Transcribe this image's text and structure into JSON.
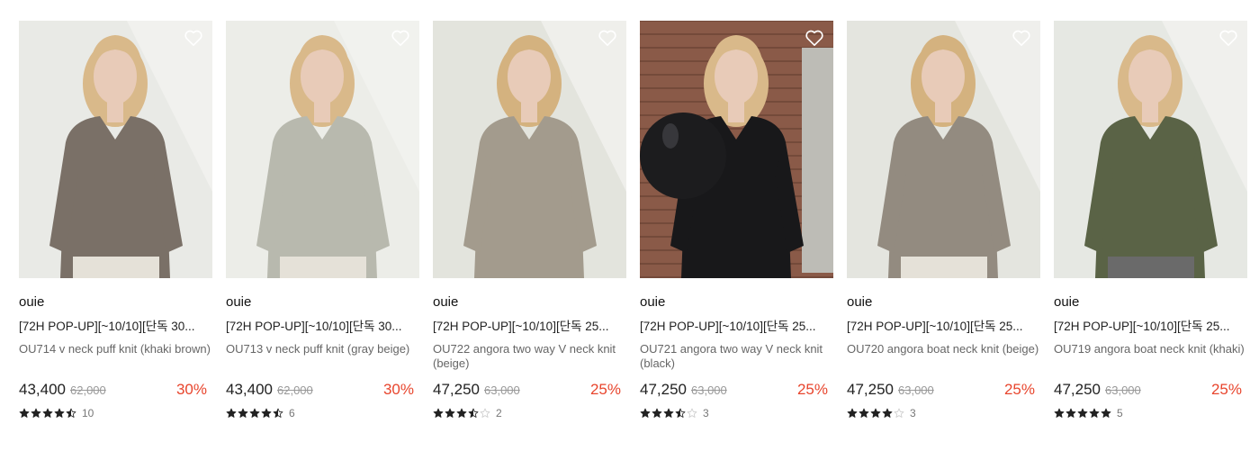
{
  "products": [
    {
      "brand": "ouie",
      "title": "[72H POP-UP][~10/10][단독 30...",
      "desc": "OU714 v neck puff knit (khaki brown)",
      "price": "43,400",
      "original_price": "62,000",
      "discount": "30%",
      "rating": 4.5,
      "review_count": "10",
      "liked": false,
      "colors": {
        "bg": "#e9eae6",
        "garment": "#7a7067",
        "hair": "#d9b98a",
        "skin": "#e8cbb8"
      }
    },
    {
      "brand": "ouie",
      "title": "[72H POP-UP][~10/10][단독 30...",
      "desc": "OU713 v neck puff knit (gray beige)",
      "price": "43,400",
      "original_price": "62,000",
      "discount": "30%",
      "rating": 4.5,
      "review_count": "6",
      "liked": false,
      "colors": {
        "bg": "#ecede8",
        "garment": "#b8b9ae",
        "hair": "#d9b98a",
        "skin": "#e8cbb8"
      }
    },
    {
      "brand": "ouie",
      "title": "[72H POP-UP][~10/10][단독 25...",
      "desc": "OU722 angora two way V neck knit (beige)",
      "price": "47,250",
      "original_price": "63,000",
      "discount": "25%",
      "rating": 3.5,
      "review_count": "2",
      "liked": false,
      "colors": {
        "bg": "#e3e4dd",
        "garment": "#a39b8d",
        "hair": "#d4b27f",
        "skin": "#e8cbb8"
      }
    },
    {
      "brand": "ouie",
      "title": "[72H POP-UP][~10/10][단독 25...",
      "desc": "OU721 angora two way V neck knit (black)",
      "price": "47,250",
      "original_price": "63,000",
      "discount": "25%",
      "rating": 3.5,
      "review_count": "3",
      "liked": false,
      "colors": {
        "bg": "#8a5a48",
        "garment": "#18181a",
        "hair": "#d9b98a",
        "skin": "#e8cbb8"
      }
    },
    {
      "brand": "ouie",
      "title": "[72H POP-UP][~10/10][단독 25...",
      "desc": "OU720 angora boat neck knit (beige)",
      "price": "47,250",
      "original_price": "63,000",
      "discount": "25%",
      "rating": 4,
      "review_count": "3",
      "liked": false,
      "colors": {
        "bg": "#e4e5df",
        "garment": "#938b80",
        "hair": "#d4b27f",
        "skin": "#e8cbb8"
      }
    },
    {
      "brand": "ouie",
      "title": "[72H POP-UP][~10/10][단독 25...",
      "desc": "OU719 angora boat neck knit (khaki)",
      "price": "47,250",
      "original_price": "63,000",
      "discount": "25%",
      "rating": 5,
      "review_count": "5",
      "liked": false,
      "colors": {
        "bg": "#e6e8e3",
        "garment": "#5a6346",
        "hair": "#d9b98a",
        "skin": "#e8cbb8"
      }
    }
  ],
  "icons": {
    "like": "heart-outline-icon",
    "rating": "star-icon"
  },
  "colors": {
    "discount": "#e8452d",
    "star_filled": "#222222",
    "star_empty": "#cccccc"
  }
}
